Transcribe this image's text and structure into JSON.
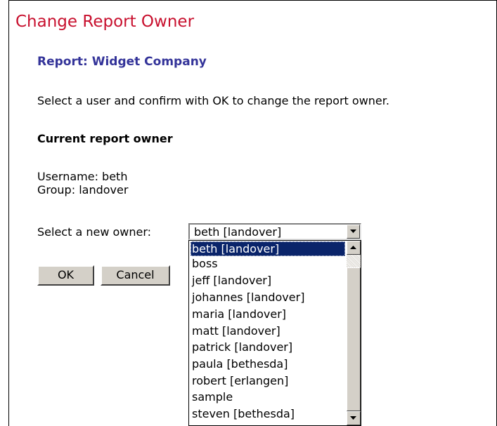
{
  "title": "Change Report Owner",
  "report_label": "Report: Widget Company",
  "instructions": "Select a user and confirm with OK to change the report owner.",
  "current_owner": {
    "heading": "Current report owner",
    "username": "Username: beth",
    "group": "Group: landover"
  },
  "owner_select": {
    "label": "Select a new owner:",
    "selected_value": "beth [landover]",
    "options": [
      "beth [landover]",
      "boss",
      "jeff [landover]",
      "johannes [landover]",
      "maria [landover]",
      "matt [landover]",
      "patrick [landover]",
      "paula [bethesda]",
      "robert [erlangen]",
      "sample",
      "steven [bethesda]"
    ]
  },
  "buttons": {
    "ok": "OK",
    "cancel": "Cancel"
  },
  "colors": {
    "title": "#c8102e",
    "report_label": "#333399",
    "selection": "#0a246a"
  }
}
